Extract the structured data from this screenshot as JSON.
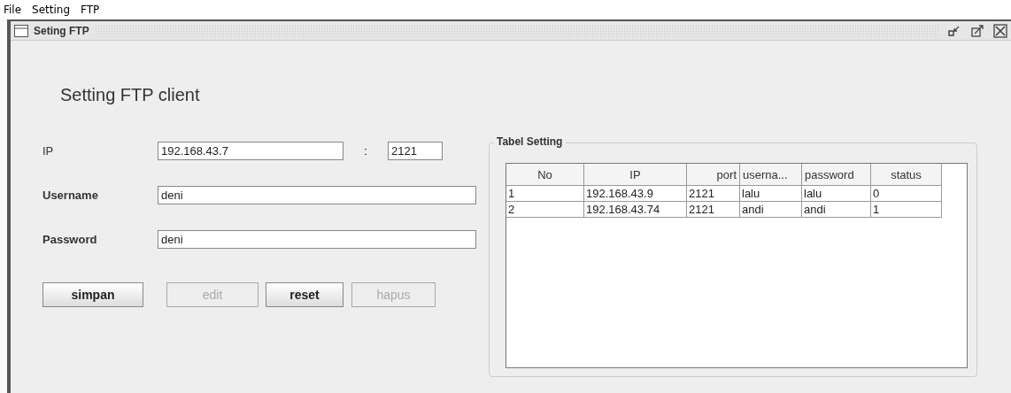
{
  "menu": [
    "File",
    "Setting",
    "FTP"
  ],
  "window": {
    "title": "Seting FTP"
  },
  "heading": "Setting FTP client",
  "form": {
    "ip_label": "IP",
    "ip": "192.168.43.7",
    "separator": ":",
    "port": "2121",
    "username_label": "Username",
    "username": "deni",
    "password_label": "Password",
    "password": "deni"
  },
  "buttons": [
    {
      "label": "simpan",
      "disabled": false
    },
    {
      "label": "edit",
      "disabled": true
    },
    {
      "label": "reset",
      "disabled": false
    },
    {
      "label": "hapus",
      "disabled": true
    }
  ],
  "table": {
    "title": "Tabel Setting",
    "columns": [
      "No",
      "IP",
      "port",
      "userna...",
      "password",
      "status"
    ],
    "rows": [
      [
        "1",
        "192.168.43.9",
        "2121",
        "lalu",
        "lalu",
        "0"
      ],
      [
        "2",
        "192.168.43.74",
        "2121",
        "andi",
        "andi",
        "1"
      ]
    ]
  }
}
